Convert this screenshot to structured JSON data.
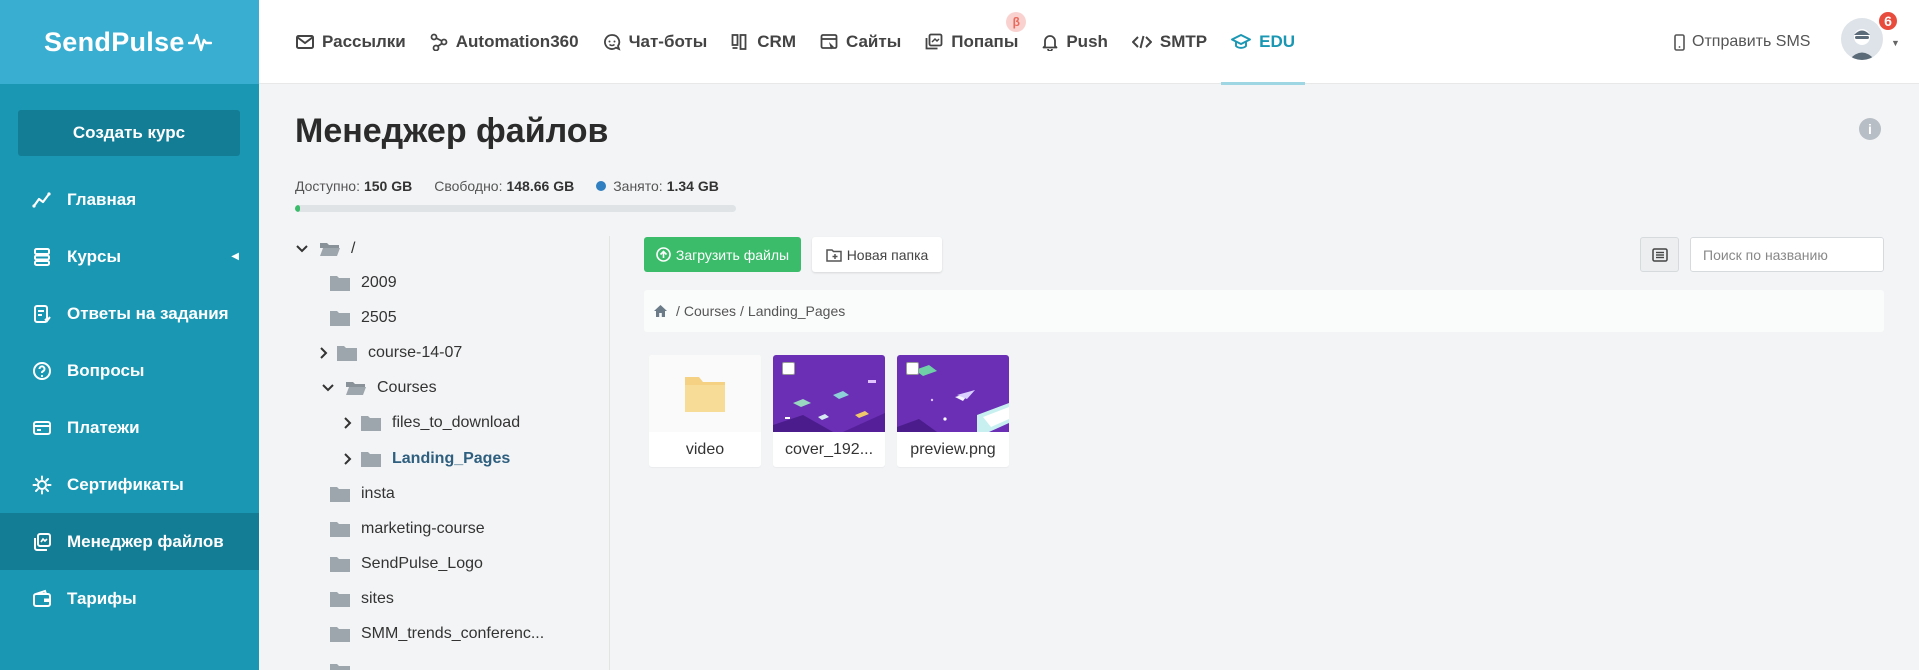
{
  "brand": {
    "name": "SendPulse",
    "colors": {
      "sidebar": "#1a97b3",
      "logo_bg": "#3aaed0",
      "active": "#137d96",
      "accent": "#1a97b3",
      "upload": "#3bbc6a",
      "badge": "#e84c3d"
    }
  },
  "sidebar": {
    "create_button": "Создать курс",
    "items": [
      {
        "label": "Главная",
        "icon": "chart-line-icon"
      },
      {
        "label": "Курсы",
        "icon": "courses-icon"
      },
      {
        "label": "Ответы на задания",
        "icon": "assignment-icon"
      },
      {
        "label": "Вопросы",
        "icon": "question-icon"
      },
      {
        "label": "Платежи",
        "icon": "payments-icon"
      },
      {
        "label": "Сертификаты",
        "icon": "certificate-icon"
      },
      {
        "label": "Менеджер файлов",
        "icon": "file-manager-icon",
        "active": true
      },
      {
        "label": "Тарифы",
        "icon": "wallet-icon"
      }
    ]
  },
  "topnav": {
    "items": [
      {
        "label": "Рассылки",
        "icon": "mail-icon"
      },
      {
        "label": "Automation360",
        "icon": "automation-icon"
      },
      {
        "label": "Чат-боты",
        "icon": "chatbot-icon"
      },
      {
        "label": "CRM",
        "icon": "crm-icon"
      },
      {
        "label": "Сайты",
        "icon": "sites-icon"
      },
      {
        "label": "Попапы",
        "icon": "popups-icon",
        "badge": "β"
      },
      {
        "label": "Push",
        "icon": "bell-icon"
      },
      {
        "label": "SMTP",
        "icon": "code-icon"
      },
      {
        "label": "EDU",
        "icon": "graduation-cap-icon",
        "active": true
      }
    ],
    "sms_label": "Отправить SMS",
    "notifications_count": "6"
  },
  "page": {
    "title": "Менеджер файлов"
  },
  "storage": {
    "available_label": "Доступно:",
    "available_value": "150 GB",
    "free_label": "Свободно:",
    "free_value": "148.66 GB",
    "used_label": "Занято:",
    "used_value": "1.34 GB",
    "used_fraction": 0.0089
  },
  "tree": {
    "root": "/",
    "items": [
      {
        "label": "2009"
      },
      {
        "label": "2505"
      },
      {
        "label": "course-14-07",
        "collapsed": true
      },
      {
        "label": "Courses",
        "expanded": true
      },
      {
        "label": "files_to_download",
        "collapsed": true
      },
      {
        "label": "Landing_Pages",
        "collapsed": true,
        "current": true
      },
      {
        "label": "insta"
      },
      {
        "label": "marketing-course"
      },
      {
        "label": "SendPulse_Logo"
      },
      {
        "label": "sites"
      },
      {
        "label": "SMM_trends_conferenc..."
      }
    ]
  },
  "toolbar": {
    "upload_label": "Загрузить файлы",
    "new_folder_label": "Новая папка",
    "search_placeholder": "Поиск по названию"
  },
  "breadcrumb": {
    "items": [
      "Courses",
      "Landing_Pages"
    ],
    "separator": "/"
  },
  "files": [
    {
      "name": "video",
      "type": "folder"
    },
    {
      "name": "cover_192...",
      "type": "image"
    },
    {
      "name": "preview.png",
      "type": "image"
    }
  ]
}
